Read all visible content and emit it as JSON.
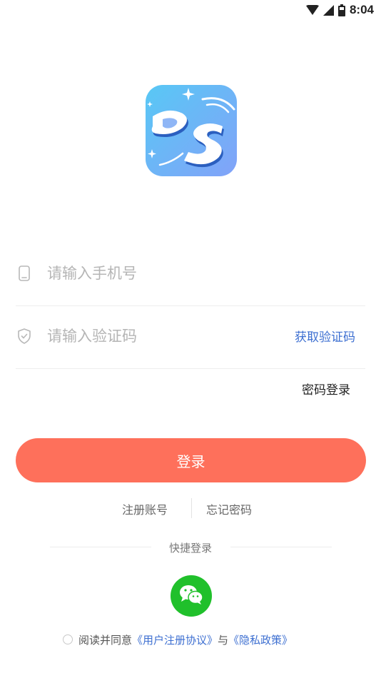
{
  "status_bar": {
    "time": "8:04",
    "icons": [
      "wifi-icon",
      "signal-icon",
      "battery-icon"
    ]
  },
  "app": {
    "logo_text": "DS",
    "logo_colors": [
      "#5bc7f4",
      "#7aa6f7"
    ]
  },
  "form": {
    "phone": {
      "placeholder": "请输入手机号",
      "value": "",
      "icon": "phone-icon"
    },
    "code": {
      "placeholder": "请输入验证码",
      "value": "",
      "icon": "shield-icon"
    },
    "get_code_label": "获取验证码",
    "password_login_label": "密码登录",
    "login_label": "登录"
  },
  "links": {
    "register": "注册账号",
    "forgot": "忘记密码"
  },
  "quick_login": {
    "title": "快捷登录",
    "providers": [
      "wechat-icon"
    ]
  },
  "agreement": {
    "prefix": "阅读并同意",
    "terms": "《用户注册协议》",
    "and": "与",
    "privacy": "《隐私政策》"
  },
  "colors": {
    "primary": "#fe705b",
    "link": "#3d6fd1",
    "wechat": "#20c02b"
  }
}
